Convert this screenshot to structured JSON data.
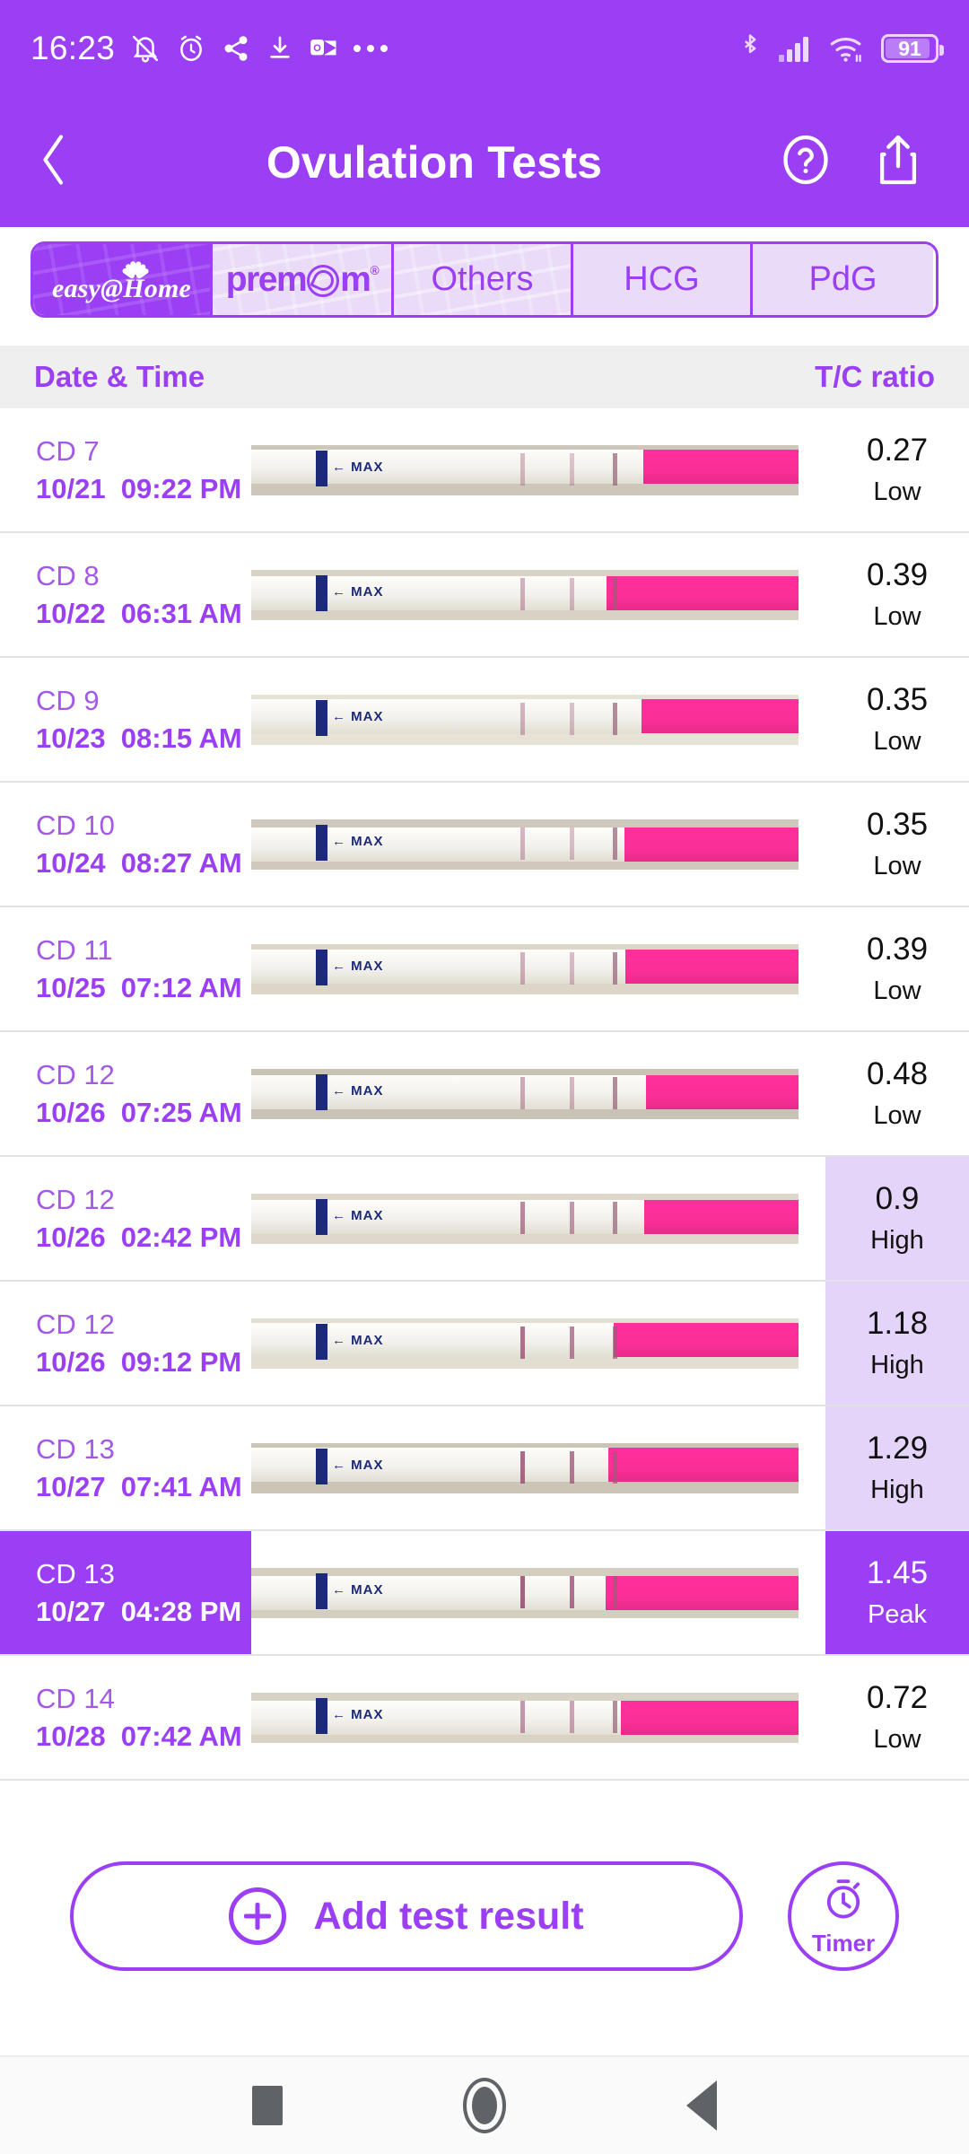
{
  "status_bar": {
    "clock": "16:23",
    "battery_percent": "91",
    "left_icons": [
      "notification-off-icon",
      "alarm-icon",
      "share-icon",
      "download-icon",
      "outlook-icon",
      "overflow-dots-icon"
    ],
    "right_icons": [
      "bluetooth-icon",
      "cellular-signal-icon",
      "wifi-icon",
      "battery-icon"
    ]
  },
  "header": {
    "title": "Ovulation Tests",
    "back_icon": "chevron-left-icon",
    "help_icon": "question-circle-icon",
    "share_icon": "share-export-icon"
  },
  "tabs": [
    {
      "id": "easyathome",
      "label": "easy@Home",
      "type": "logo",
      "active": true
    },
    {
      "id": "premom",
      "label": "premom",
      "type": "logo",
      "active": false
    },
    {
      "id": "others",
      "label": "Others",
      "type": "text",
      "active": false
    },
    {
      "id": "hcg",
      "label": "HCG",
      "type": "text",
      "active": false
    },
    {
      "id": "pdg",
      "label": "PdG",
      "type": "text",
      "active": false
    }
  ],
  "table": {
    "columns": {
      "date_time": "Date & Time",
      "ratio": "T/C ratio"
    },
    "rows": [
      {
        "cd": "CD 7",
        "date": "10/21",
        "time": "09:22 PM",
        "ratio": "0.27",
        "level": "Low",
        "strip_alt": "ovulation-test-strip-photo"
      },
      {
        "cd": "CD 8",
        "date": "10/22",
        "time": "06:31 AM",
        "ratio": "0.39",
        "level": "Low",
        "strip_alt": "ovulation-test-strip-photo"
      },
      {
        "cd": "CD 9",
        "date": "10/23",
        "time": "08:15 AM",
        "ratio": "0.35",
        "level": "Low",
        "strip_alt": "ovulation-test-strip-photo"
      },
      {
        "cd": "CD 10",
        "date": "10/24",
        "time": "08:27 AM",
        "ratio": "0.35",
        "level": "Low",
        "strip_alt": "ovulation-test-strip-photo"
      },
      {
        "cd": "CD 11",
        "date": "10/25",
        "time": "07:12 AM",
        "ratio": "0.39",
        "level": "Low",
        "strip_alt": "ovulation-test-strip-photo"
      },
      {
        "cd": "CD 12",
        "date": "10/26",
        "time": "07:25 AM",
        "ratio": "0.48",
        "level": "Low",
        "strip_alt": "ovulation-test-strip-photo"
      },
      {
        "cd": "CD 12",
        "date": "10/26",
        "time": "02:42 PM",
        "ratio": "0.9",
        "level": "High",
        "strip_alt": "ovulation-test-strip-photo"
      },
      {
        "cd": "CD 12",
        "date": "10/26",
        "time": "09:12 PM",
        "ratio": "1.18",
        "level": "High",
        "strip_alt": "ovulation-test-strip-photo"
      },
      {
        "cd": "CD 13",
        "date": "10/27",
        "time": "07:41 AM",
        "ratio": "1.29",
        "level": "High",
        "strip_alt": "ovulation-test-strip-photo"
      },
      {
        "cd": "CD 13",
        "date": "10/27",
        "time": "04:28 PM",
        "ratio": "1.45",
        "level": "Peak",
        "strip_alt": "ovulation-test-strip-photo"
      },
      {
        "cd": "CD 14",
        "date": "10/28",
        "time": "07:42 AM",
        "ratio": "0.72",
        "level": "Low",
        "strip_alt": "ovulation-test-strip-photo"
      }
    ]
  },
  "actions": {
    "add_label": "Add test result",
    "add_icon": "plus-circle-icon",
    "timer_label": "Timer",
    "timer_icon": "stopwatch-icon"
  },
  "nav_bar": {
    "recents_icon": "square-recents-icon",
    "home_icon": "circle-home-icon",
    "back_icon": "triangle-back-icon"
  },
  "colors": {
    "brand_purple": "#9B3FF5",
    "high_bg": "#E5D4FA",
    "tab_inactive_bg": "#EADCF8",
    "header_row_bg": "#EFEFEF",
    "strip_pink": "#FF2F9B"
  }
}
